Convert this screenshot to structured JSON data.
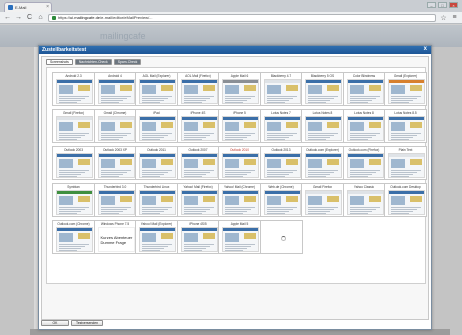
{
  "browser": {
    "tab_title": "E-Mail",
    "tab_close": "×",
    "address_prefix": "https://",
    "address_host": "ui.mailingcafe.de",
    "address_path": "/e-mail/editor/eMailPreview/...",
    "min": "–",
    "max": "□",
    "close": "×",
    "back": "←",
    "forward": "→",
    "reload": "C",
    "home": "⌂",
    "star": "☆",
    "menu": "≡"
  },
  "app": {
    "logo_a": "mailing",
    "logo_b": "cafe"
  },
  "dialog": {
    "title": "Zustellbarkeitstest",
    "close": "x",
    "tabs": [
      {
        "label": "Screenshots",
        "active": true
      },
      {
        "label": "Nachrichten-Check",
        "active": false
      },
      {
        "label": "Spam-Check",
        "active": false
      }
    ],
    "buttons": {
      "ok": "OK",
      "second": "Testversenden"
    }
  },
  "thumbnails": [
    {
      "label": "Android 2.3",
      "style": "blue"
    },
    {
      "label": "Android 4",
      "style": "blue"
    },
    {
      "label": "AOL Mail (Explorer)",
      "style": "blue"
    },
    {
      "label": "AOL Mail (Firefox)",
      "style": "blue"
    },
    {
      "label": "Apple Mail 6",
      "style": "gray"
    },
    {
      "label": "Blackberry 4.7",
      "style": "white"
    },
    {
      "label": "Blackberry 5 OS",
      "style": "blue"
    },
    {
      "label": "Color Blindness",
      "style": "blue"
    },
    {
      "label": "Gmail (Explorer)",
      "style": "orange"
    },
    {
      "label": "Gmail (Firefox)",
      "style": "white"
    },
    {
      "label": "Gmail (Chrome)",
      "style": "white"
    },
    {
      "label": "iPad",
      "style": "blue"
    },
    {
      "label": "iPhone 4S",
      "style": "blue"
    },
    {
      "label": "iPhone 5",
      "style": "blue"
    },
    {
      "label": "Lotus Notes 7",
      "style": "blue"
    },
    {
      "label": "Lotus Notes 8",
      "style": "blue"
    },
    {
      "label": "Lotus Notes 8",
      "style": "blue"
    },
    {
      "label": "Lotus Notes 8.5",
      "style": "blue"
    },
    {
      "label": "Outlook 2003",
      "style": "blue"
    },
    {
      "label": "Outlook 2003 XP",
      "style": "blue"
    },
    {
      "label": "Outlook 2011",
      "style": "blue"
    },
    {
      "label": "Outlook 2007",
      "style": "blue"
    },
    {
      "label": "Outlook 2010",
      "style": "blue",
      "red": true
    },
    {
      "label": "Outlook 2013",
      "style": "blue"
    },
    {
      "label": "Outlook.com (Explorer)",
      "style": "blue"
    },
    {
      "label": "Outlook.com (Firefox)",
      "style": "blue"
    },
    {
      "label": "Plain Text",
      "style": "white"
    },
    {
      "label": "Symbian",
      "style": "green"
    },
    {
      "label": "Thunderbird 3.0",
      "style": "blue"
    },
    {
      "label": "Thunderbird Linux",
      "style": "blue"
    },
    {
      "label": "Yahoo! Mail (Firefox)",
      "style": "blue"
    },
    {
      "label": "Yahoo! Mail (Chrome)",
      "style": "blue"
    },
    {
      "label": "Web.de (Chrome)",
      "style": "blue"
    },
    {
      "label": "Gmail Firefox",
      "style": "white"
    },
    {
      "label": "Yahoo Classic",
      "style": "white"
    },
    {
      "label": "Outlook.com Desktop",
      "style": "blue"
    },
    {
      "label": "Outlook.com (Chrome)",
      "style": "blue"
    },
    {
      "label": "Windows Phone 7.5",
      "style": "plain",
      "wp": true
    },
    {
      "label": "Yahoo! Mail (Explorer)",
      "style": "blue"
    },
    {
      "label": "iPhone 4S/5",
      "style": "blue"
    },
    {
      "label": "Apple Mail 5",
      "style": "blue"
    },
    {
      "label": "",
      "style": "plain",
      "spinner": true
    }
  ],
  "winphone_text": [
    "Kurzes Abenteuer",
    "Dumme Frage"
  ],
  "colors": {
    "dialog_title": "#1d5596",
    "inactive_tab": "#6c7680"
  }
}
